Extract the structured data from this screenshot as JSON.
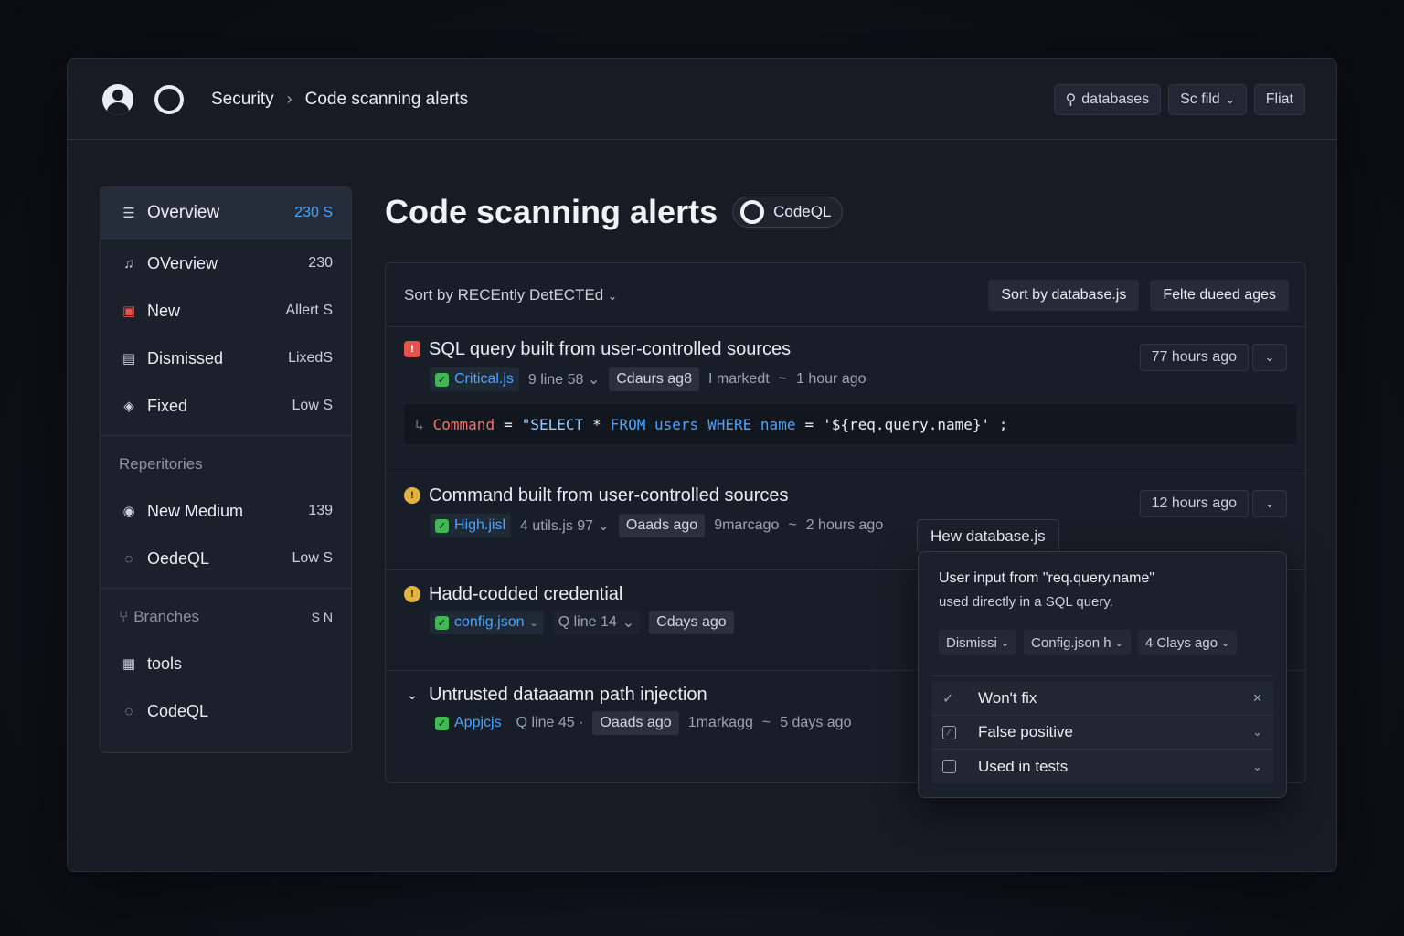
{
  "header": {
    "breadcrumb_root": "Security",
    "breadcrumb_current": "Code scanning alerts",
    "actions": [
      {
        "label": "databases",
        "icon": "search-icon"
      },
      {
        "label": "Sc fild",
        "icon": "chevron-down-icon"
      },
      {
        "label": "Fliat"
      }
    ]
  },
  "sidebar": {
    "items": [
      {
        "label": "Overview",
        "count": "230 S"
      },
      {
        "label": "OVerview",
        "count": "230"
      },
      {
        "label": "New",
        "count": "Allert S"
      },
      {
        "label": "Dismissed",
        "count": "LixedS"
      },
      {
        "label": "Fixed",
        "count": "Low S"
      }
    ],
    "repos_heading": "Reperitories",
    "repo_items": [
      {
        "label": "New Medium",
        "count": "139"
      },
      {
        "label": "OedeQL",
        "count": "Low S"
      }
    ],
    "branches_heading": "Branches",
    "branches_count": "S N",
    "branch_items": [
      {
        "label": "tools"
      },
      {
        "label": "CodeQL"
      }
    ]
  },
  "page": {
    "title": "Code scanning alerts",
    "tool_badge": "CodeQL"
  },
  "panel": {
    "sort_label": "Sort by RECEntly DetECTEd",
    "head_buttons": [
      "Sort by database.js",
      "Felte dueed ages"
    ]
  },
  "alerts": [
    {
      "title": "SQL query built from user-controlled sources",
      "time": "77 hours ago",
      "file": "Critical.js",
      "line": "9 line 58",
      "chip": "Cdaurs ag8",
      "marked": "I markedt",
      "ago": "1 hour ago",
      "code": {
        "var": "Command",
        "eq": "=",
        "str1": "\"SELECT",
        "star": "*",
        "from": "FROM users",
        "where": "WHERE name",
        "eq2": "=",
        "tail": "'${req.query.name}' ;"
      }
    },
    {
      "title": "Command built from user-controlled sources",
      "time": "12 hours ago",
      "file": "High.jisl",
      "line": "4 utils.js 97",
      "chip": "Oaads ago",
      "marked": "9marcago",
      "ago": "2 hours ago"
    },
    {
      "title": "Hadd-codded credential",
      "file": "config.json",
      "line": "Q line 14",
      "chip": "Cdays ago"
    },
    {
      "title": "Untrusted dataaamn path injection",
      "file": "Appjcjs",
      "line": "Q line 45",
      "chip": "Oaads ago",
      "marked": "1markagg",
      "ago": "5 days ago"
    }
  ],
  "popover": {
    "tab": "Hew database.js",
    "text1": "User input from \"req.query.name\"",
    "text2": "used directly in a SQL query.",
    "chips": [
      "Dismissi",
      "Config.json h",
      "4 Clays ago"
    ],
    "options": [
      "Won't fix",
      "False positive",
      "Used in tests"
    ]
  },
  "colors": {
    "accent": "#4aa3ff",
    "critical": "#e5534b",
    "warning": "#e3b341",
    "success": "#3fb950"
  }
}
